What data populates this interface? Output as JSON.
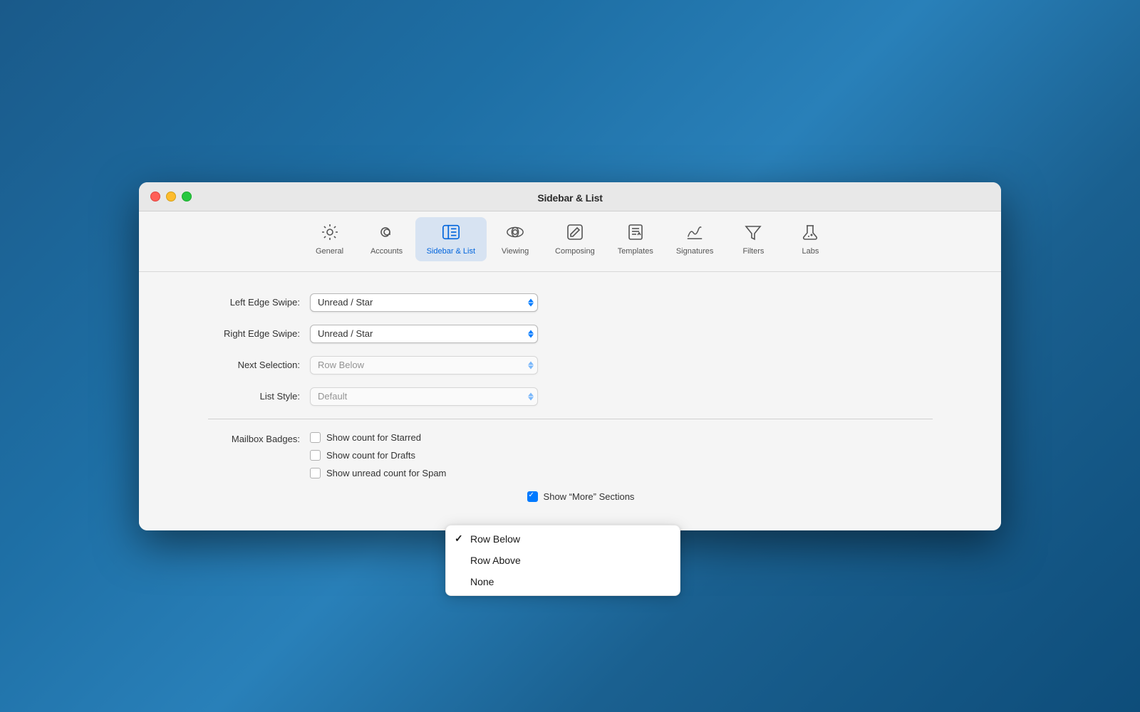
{
  "window": {
    "title": "Sidebar & List"
  },
  "toolbar": {
    "items": [
      {
        "id": "general",
        "label": "General",
        "icon": "gear"
      },
      {
        "id": "accounts",
        "label": "Accounts",
        "icon": "at"
      },
      {
        "id": "sidebar-list",
        "label": "Sidebar & List",
        "icon": "sidebar",
        "active": true
      },
      {
        "id": "viewing",
        "label": "Viewing",
        "icon": "viewing"
      },
      {
        "id": "composing",
        "label": "Composing",
        "icon": "composing"
      },
      {
        "id": "templates",
        "label": "Templates",
        "icon": "templates"
      },
      {
        "id": "signatures",
        "label": "Signatures",
        "icon": "signatures"
      },
      {
        "id": "filters",
        "label": "Filters",
        "icon": "filters"
      },
      {
        "id": "labs",
        "label": "Labs",
        "icon": "labs"
      }
    ]
  },
  "content": {
    "left_edge_swipe_label": "Left Edge Swipe:",
    "left_edge_swipe_value": "Unread / Star",
    "right_edge_swipe_label": "Right Edge Swipe:",
    "right_edge_swipe_value": "Unread / Star",
    "next_selection_label": "Next Selection:",
    "list_style_label": "List Style:",
    "mailbox_badges_label": "Mailbox Badges:",
    "show_count_starred": "Show count for Starred",
    "show_count_drafts": "Show count for Drafts",
    "show_unread_spam": "Show unread count for Spam",
    "show_more_sections": "Show “More” Sections"
  },
  "dropdown": {
    "items": [
      {
        "id": "row-below",
        "label": "Row Below",
        "checked": true
      },
      {
        "id": "row-above",
        "label": "Row Above",
        "checked": false
      },
      {
        "id": "none",
        "label": "None",
        "checked": false
      }
    ]
  },
  "checkboxes": {
    "show_count_starred": false,
    "show_count_drafts": false,
    "show_unread_spam": false,
    "show_more_sections": true
  }
}
